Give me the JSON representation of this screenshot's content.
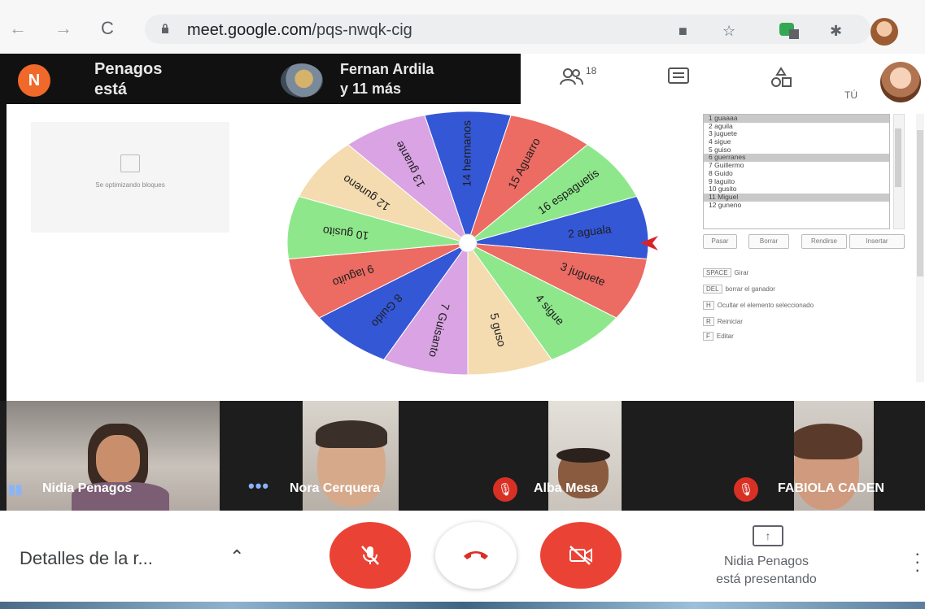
{
  "browser": {
    "url_host": "meet.google.com",
    "url_path": "/pqs-nwqk-cig",
    "icons": [
      "back-arrow-icon",
      "forward-arrow-icon",
      "reload-icon",
      "lock-icon",
      "camera-icon",
      "star-icon",
      "extension-icon",
      "puzzle-icon",
      "profile-avatar-icon"
    ]
  },
  "top_strip": {
    "presenter_initial": "N",
    "presenter_line1": "Penagos",
    "presenter_line2": "está",
    "group_line1": "Fernan Ardila",
    "group_line2": "y 11 más",
    "people_count": "18",
    "self_label": "TÚ"
  },
  "stage": {
    "tile_text": "Se optimizando bloques",
    "wheel": {
      "segments": [
        {
          "label": "14 hermanos",
          "color": "#3457d5"
        },
        {
          "label": "15 Aguarro",
          "color": "#ec6b63"
        },
        {
          "label": "16 espaguetis",
          "color": "#8ee88b"
        },
        {
          "label": "2 aguala",
          "color": "#3457d5"
        },
        {
          "label": "3 juguete",
          "color": "#ec6b63"
        },
        {
          "label": "4 sigue",
          "color": "#8ee88b"
        },
        {
          "label": "5 guso",
          "color": "#f4dcb0"
        },
        {
          "label": "7 Guisanto",
          "color": "#d9a3e4"
        },
        {
          "label": "8 Guido",
          "color": "#3457d5"
        },
        {
          "label": "9 laguito",
          "color": "#ec6b63"
        },
        {
          "label": "10 gusito",
          "color": "#8ee88b"
        },
        {
          "label": "12 guneno",
          "color": "#f4dcb0"
        },
        {
          "label": "13 guante",
          "color": "#d9a3e4"
        }
      ],
      "pointer_color": "#d9232a"
    },
    "name_list": [
      {
        "text": "1 guaaaa",
        "selected": true
      },
      {
        "text": "2 aguila",
        "selected": false
      },
      {
        "text": "3 juguete",
        "selected": false
      },
      {
        "text": "4 sigue",
        "selected": false
      },
      {
        "text": "5 guiso",
        "selected": false
      },
      {
        "text": "6 guerranes",
        "selected": true
      },
      {
        "text": "7 Guillermo",
        "selected": false
      },
      {
        "text": "8 Guido",
        "selected": false
      },
      {
        "text": "9 laguito",
        "selected": false
      },
      {
        "text": "10 gusito",
        "selected": false
      },
      {
        "text": "11 Miguel",
        "selected": true
      },
      {
        "text": "12 guneno",
        "selected": false
      }
    ],
    "list_buttons": [
      "Pasar",
      "Borrar",
      "Rendirse",
      "Insertar"
    ],
    "legend": [
      {
        "key": "SPACE",
        "text": "Girar"
      },
      {
        "key": "DEL",
        "text": "borrar el ganador"
      },
      {
        "key": "H",
        "text": "Ocultar el elemento seleccionado"
      },
      {
        "key": "R",
        "text": "Reiniciar"
      },
      {
        "key": "F",
        "text": "Editar"
      }
    ]
  },
  "participants": [
    {
      "name": "Nidia Penagos",
      "status": "speaking"
    },
    {
      "name": "Nora Cerquera",
      "status": "dots"
    },
    {
      "name": "Alba Mesa",
      "status": "muted"
    },
    {
      "name": "FABIOLA CADEN",
      "status": "muted"
    }
  ],
  "bottom": {
    "details_label": "Detalles de la r...",
    "presenting_line1": "Nidia Penagos",
    "presenting_line2": "está presentando"
  }
}
